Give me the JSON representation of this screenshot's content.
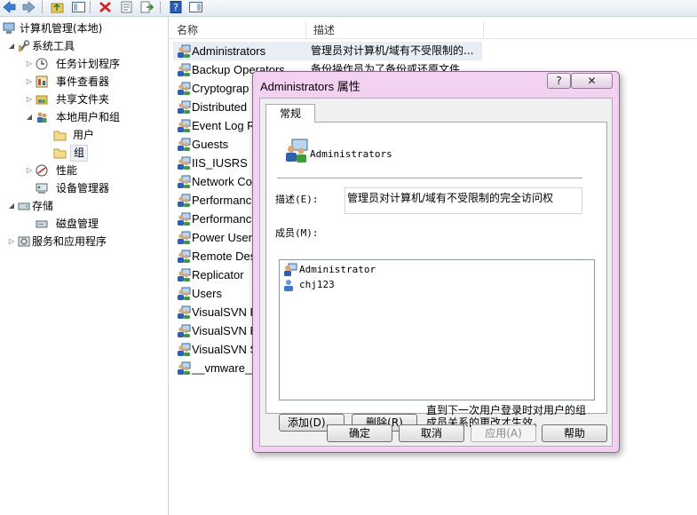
{
  "tree": {
    "items": [
      {
        "label": "计算机管理(本地)",
        "level": 0,
        "expanded": true
      },
      {
        "label": "系统工具",
        "level": 1,
        "expanded": true
      },
      {
        "label": "任务计划程序",
        "level": 2,
        "expanded": false
      },
      {
        "label": "事件查看器",
        "level": 2,
        "expanded": false
      },
      {
        "label": "共享文件夹",
        "level": 2,
        "expanded": false
      },
      {
        "label": "本地用户和组",
        "level": 2,
        "expanded": true
      },
      {
        "label": "用户",
        "level": 3
      },
      {
        "label": "组",
        "level": 3,
        "selected": true
      },
      {
        "label": "性能",
        "level": 2,
        "expanded": false
      },
      {
        "label": "设备管理器",
        "level": 2
      },
      {
        "label": "存储",
        "level": 1,
        "expanded": true
      },
      {
        "label": "磁盘管理",
        "level": 2
      },
      {
        "label": "服务和应用程序",
        "level": 1,
        "expanded": false
      }
    ]
  },
  "list": {
    "columns": [
      "名称",
      "描述"
    ],
    "rows": [
      {
        "name": "Administrators",
        "desc": "管理员对计算机/域有不受限制的..."
      },
      {
        "name": "Backup Operators",
        "desc": "备份操作员为了备份或还原文件..."
      },
      {
        "name": "Cryptograp",
        "desc": ""
      },
      {
        "name": "Distributed",
        "desc": ""
      },
      {
        "name": "Event Log R",
        "desc": ""
      },
      {
        "name": "Guests",
        "desc": ""
      },
      {
        "name": "IIS_IUSRS",
        "desc": ""
      },
      {
        "name": "Network Co",
        "desc": ""
      },
      {
        "name": "Performanc",
        "desc": ""
      },
      {
        "name": "Performanc",
        "desc": ""
      },
      {
        "name": "Power User",
        "desc": ""
      },
      {
        "name": "Remote Des",
        "desc": ""
      },
      {
        "name": "Replicator",
        "desc": ""
      },
      {
        "name": "Users",
        "desc": ""
      },
      {
        "name": "VisualSVN R",
        "desc": ""
      },
      {
        "name": "VisualSVN R",
        "desc": ""
      },
      {
        "name": "VisualSVN S",
        "desc": ""
      },
      {
        "name": "__vmware__",
        "desc": ""
      }
    ]
  },
  "dialog": {
    "title": "Administrators 属性",
    "help_label": "?",
    "close_label": "✕",
    "tab_label": "常规",
    "group_name": "Administrators",
    "desc_label": "描述(E):",
    "desc_value": "管理员对计算机/域有不受限制的完全访问权",
    "members_label": "成员(M):",
    "members": [
      "Administrator",
      "chj123"
    ],
    "add_label": "添加(D)...",
    "remove_label": "删除(R)",
    "note_line1": "直到下一次用户登录时对用户的组",
    "note_line2": "成员关系的更改才生效。",
    "ok_label": "确定",
    "cancel_label": "取消",
    "apply_label": "应用(A)",
    "help_button_label": "帮助"
  }
}
